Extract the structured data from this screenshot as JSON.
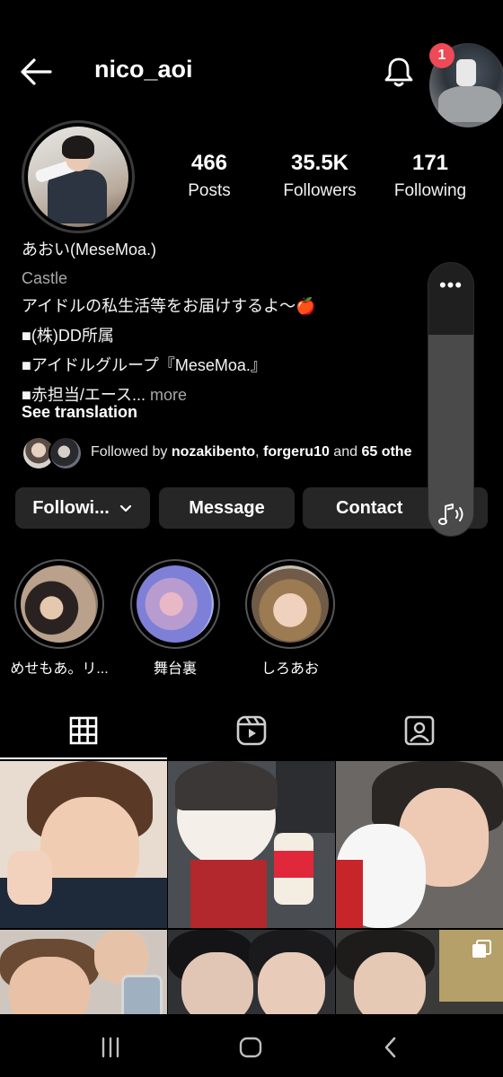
{
  "header": {
    "username": "nico_aoi",
    "notification_count": "1"
  },
  "profile": {
    "stats": [
      {
        "value": "466",
        "label": "Posts"
      },
      {
        "value": "35.5K",
        "label": "Followers"
      },
      {
        "value": "171",
        "label": "Following"
      }
    ],
    "name": "あおい(MeseMoa.)",
    "category": "Castle",
    "bio_lines": [
      "アイドルの私生活等をお届けするよ〜🍎",
      "■(株)DD所属",
      "■アイドルグループ『MeseMoa.』",
      "■赤担当/エース..."
    ],
    "more_label": "more",
    "see_translation": "See translation",
    "followed_by": {
      "prefix": "Followed by ",
      "user1": "nozakibento",
      "sep": ", ",
      "user2": "forgeru10",
      "mid": " and ",
      "others": "65 othe"
    }
  },
  "buttons": {
    "following": "Followi...",
    "message": "Message",
    "contact": "Contact"
  },
  "highlights": [
    {
      "label": "めせもあ。リ..."
    },
    {
      "label": "舞台裏"
    },
    {
      "label": "しろあお"
    }
  ],
  "colors": {
    "background": "#000000",
    "button_bg": "#262626",
    "notification_badge": "#ed4956",
    "secondary_text": "#a8a8a8"
  },
  "icons": {
    "back": "arrow-left-icon",
    "bell": "bell-icon",
    "chevron": "chevron-down-icon",
    "grid": "grid-icon",
    "reels": "reels-icon",
    "tagged": "tagged-icon",
    "volume": "volume-icon"
  }
}
